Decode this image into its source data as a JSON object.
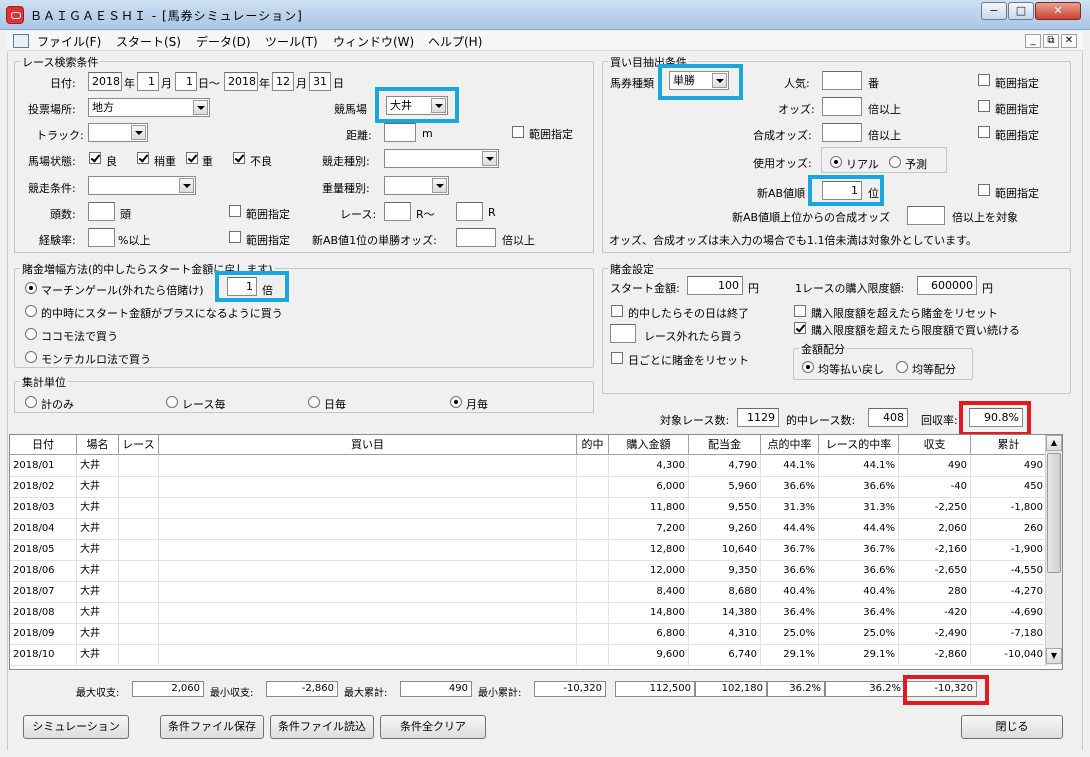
{
  "window": {
    "title": "ＢＡＩＧＡＥＳＨＩ - [馬券シミュレーション]",
    "min": "−",
    "max": "□",
    "close": "✕"
  },
  "menu": [
    "ファイル(F)",
    "スタート(S)",
    "データ(D)",
    "ツール(T)",
    "ウィンドウ(W)",
    "ヘルプ(H)"
  ],
  "mdi": {
    "min": "_",
    "restore": "⧉",
    "close": "✕"
  },
  "race_search": {
    "legend": "レース検索条件",
    "date_label": "日付:",
    "from_year": "2018",
    "year_u": "年",
    "from_month": "1",
    "month_u": "月",
    "from_day": "1",
    "day_sep": "日〜",
    "to_year": "2018",
    "to_month": "12",
    "to_day": "31",
    "to_day_u": "日",
    "venue_type_label": "投票場所:",
    "venue_type": "地方",
    "track_label": "競馬場",
    "track": "大井",
    "surface_label": "トラック:",
    "surface": "",
    "distance_label": "距離:",
    "distance": "",
    "distance_unit": "m",
    "range_label": "範囲指定",
    "condition_label": "馬場状態:",
    "cond": [
      {
        "label": "良",
        "checked": true
      },
      {
        "label": "稍重",
        "checked": true
      },
      {
        "label": "重",
        "checked": true
      },
      {
        "label": "不良",
        "checked": true
      }
    ],
    "race_kind_label": "競走種別:",
    "race_kind": "",
    "race_cond_label": "競走条件:",
    "race_cond": "",
    "weight_label": "重量種別:",
    "weight": "",
    "heads_label": "頭数:",
    "heads": "",
    "heads_unit": "頭",
    "race_label": "レース:",
    "race_from": "",
    "race_sep": "R〜",
    "race_to": "",
    "race_unit": "R",
    "exp_label": "経験率:",
    "exp": "",
    "exp_unit": "%以上",
    "newab_label": "新AB値1位の単勝オッズ:",
    "newab_odds": "",
    "newab_unit": "倍以上"
  },
  "bet_filter": {
    "legend": "買い目抽出条件",
    "kind_label": "馬券種類",
    "kind": "単勝",
    "pop_label": "人気:",
    "pop": "",
    "pop_unit": "番",
    "odds_label": "オッズ:",
    "odds": "",
    "odds_unit": "倍以上",
    "comb_label": "合成オッズ:",
    "comb": "",
    "comb_unit": "倍以上",
    "range_label": "範囲指定",
    "use_odds_label": "使用オッズ:",
    "real": "リアル",
    "forecast": "予測",
    "newab_rank_label": "新AB値順",
    "newab_rank": "1",
    "newab_rank_unit": "位",
    "newab_top_label": "新AB値順上位からの合成オッズ",
    "newab_top": "",
    "newab_top_unit": "倍以上を対象",
    "note": "オッズ、合成オッズは未入力の場合でも1.1倍未満は対象外としています。"
  },
  "bet_increase": {
    "legend": "賭金増幅方法(的中したらスタート金額に戻します)",
    "opt1": "マーチンゲール(外れたら倍賭け)",
    "mult": "1",
    "mult_unit": "倍",
    "opt2": "的中時にスタート金額がプラスになるように買う",
    "opt3": "ココモ法で買う",
    "opt4": "モンテカルロ法で買う"
  },
  "bet_settings": {
    "legend": "賭金設定",
    "start_label": "スタート金額:",
    "start": "100",
    "yen": "円",
    "limit_label": "1レースの購入限度額:",
    "limit": "600000",
    "stop_label": "的中したらその日は終了",
    "miss_label": "レース外れたら買う",
    "miss": "",
    "reset_day_label": "日ごとに賭金をリセット",
    "reset_limit_label": "購入限度額を超えたら賭金をリセット",
    "keep_limit_label": "購入限度額を超えたら限度額で買い続ける",
    "alloc_legend": "金額配分",
    "alloc1": "均等払い戻し",
    "alloc2": "均等配分"
  },
  "aggregate": {
    "legend": "集計単位",
    "opts": [
      "計のみ",
      "レース毎",
      "日毎",
      "月毎"
    ],
    "selected": 3
  },
  "stats": {
    "target_label": "対象レース数:",
    "target": "1129",
    "hit_label": "的中レース数:",
    "hit": "408",
    "recovery_label": "回収率:",
    "recovery": "90.8%"
  },
  "table": {
    "headers": [
      "日付",
      "場名",
      "レース",
      "買い目",
      "的中",
      "購入金額",
      "配当金",
      "点的中率",
      "レース的中率",
      "収支",
      "累計"
    ],
    "rows": [
      [
        "2018/01",
        "大井",
        "",
        "",
        "",
        "4,300",
        "4,790",
        "44.1%",
        "44.1%",
        "490",
        "490"
      ],
      [
        "2018/02",
        "大井",
        "",
        "",
        "",
        "6,000",
        "5,960",
        "36.6%",
        "36.6%",
        "-40",
        "450"
      ],
      [
        "2018/03",
        "大井",
        "",
        "",
        "",
        "11,800",
        "9,550",
        "31.3%",
        "31.3%",
        "-2,250",
        "-1,800"
      ],
      [
        "2018/04",
        "大井",
        "",
        "",
        "",
        "7,200",
        "9,260",
        "44.4%",
        "44.4%",
        "2,060",
        "260"
      ],
      [
        "2018/05",
        "大井",
        "",
        "",
        "",
        "12,800",
        "10,640",
        "36.7%",
        "36.7%",
        "-2,160",
        "-1,900"
      ],
      [
        "2018/06",
        "大井",
        "",
        "",
        "",
        "12,000",
        "9,350",
        "36.6%",
        "36.6%",
        "-2,650",
        "-4,550"
      ],
      [
        "2018/07",
        "大井",
        "",
        "",
        "",
        "8,400",
        "8,680",
        "40.4%",
        "40.4%",
        "280",
        "-4,270"
      ],
      [
        "2018/08",
        "大井",
        "",
        "",
        "",
        "14,800",
        "14,380",
        "36.4%",
        "36.4%",
        "-420",
        "-4,690"
      ],
      [
        "2018/09",
        "大井",
        "",
        "",
        "",
        "6,800",
        "4,310",
        "25.0%",
        "25.0%",
        "-2,490",
        "-7,180"
      ],
      [
        "2018/10",
        "大井",
        "",
        "",
        "",
        "9,600",
        "6,740",
        "29.1%",
        "29.1%",
        "-2,860",
        "-10,040"
      ]
    ]
  },
  "footer": {
    "max_label": "最大収支:",
    "max": "2,060",
    "min_label": "最小収支:",
    "min": "-2,860",
    "maxcum_label": "最大累計:",
    "maxcum": "490",
    "mincum_label": "最小累計:",
    "mincum": "-10,320",
    "total_buy": "112,500",
    "total_pay": "102,180",
    "total_hit": "36.2%",
    "total_race_hit": "36.2%",
    "total_balance": "-10,320"
  },
  "buttons": {
    "simulate": "シミュレーション",
    "save": "条件ファイル保存",
    "load": "条件ファイル読込",
    "clear": "条件全クリア",
    "close": "閉じる"
  }
}
